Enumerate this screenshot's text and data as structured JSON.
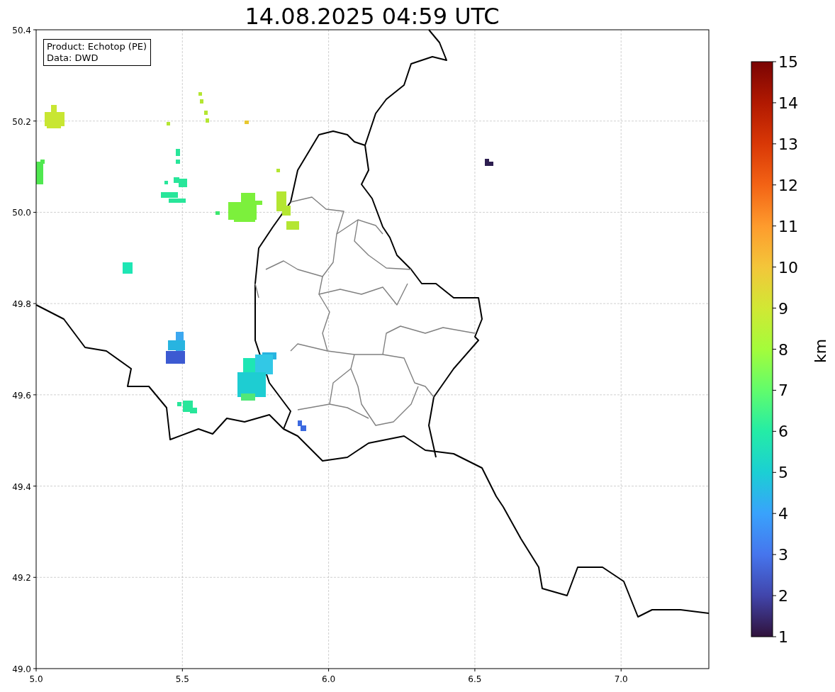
{
  "title": "14.08.2025 04:59 UTC",
  "info_box": [
    "Product: Echotop (PE)",
    "Data: DWD"
  ],
  "x_axis": {
    "ticks": [
      "5.0",
      "5.5",
      "6.0",
      "6.5",
      "7.0"
    ]
  },
  "y_axis": {
    "ticks": [
      "50.4",
      "50.2",
      "50.0",
      "49.8",
      "49.6",
      "49.4",
      "49.2",
      "49.0"
    ]
  },
  "colorbar": {
    "label": "km",
    "ticks": [
      "15",
      "14",
      "13",
      "12",
      "11",
      "10",
      "9",
      "8",
      "7",
      "6",
      "5",
      "4",
      "3",
      "2",
      "1"
    ]
  }
}
